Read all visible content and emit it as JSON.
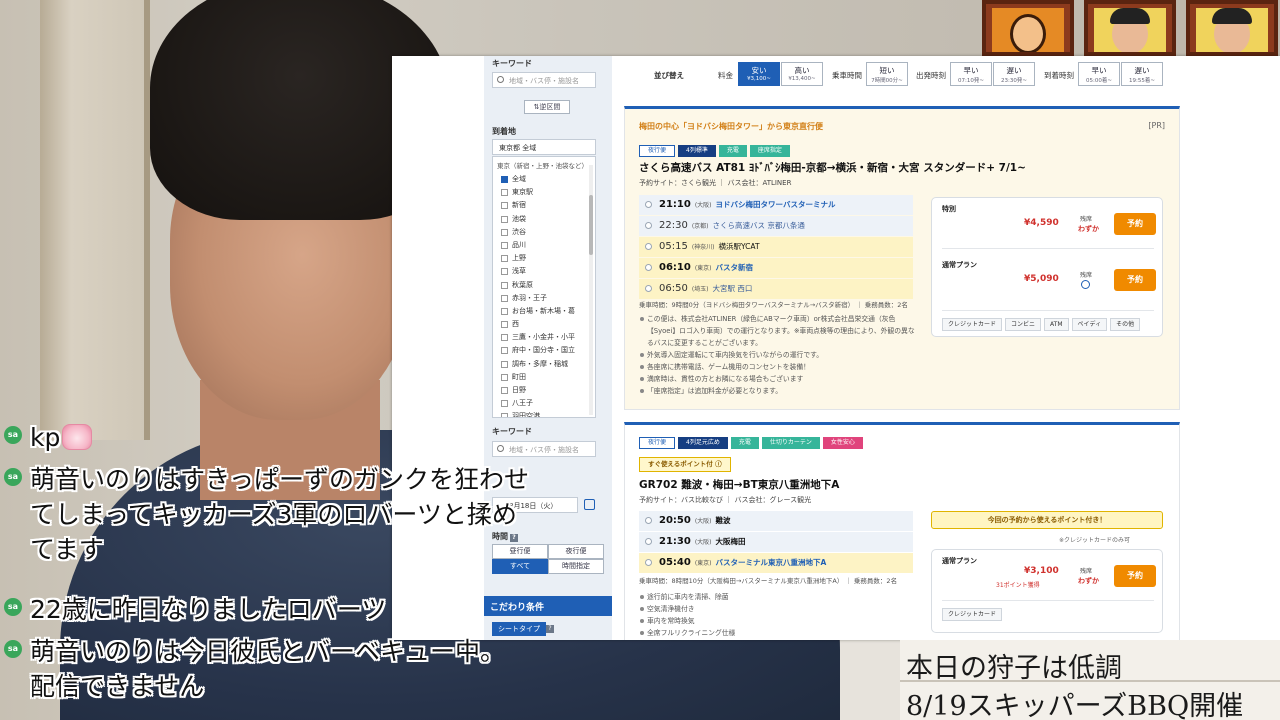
{
  "sidebar": {
    "keyword_label_top": "キーワード",
    "keyword_placeholder_top": "地域・バス停・施設名",
    "swap_label": "⇅逆区間",
    "destination_label": "到着地",
    "destination_value": "東京都 全域",
    "group_label": "東京（新宿・上野・池袋など）",
    "items": [
      {
        "label": "全域",
        "checked": true
      },
      {
        "label": "東京駅",
        "checked": false
      },
      {
        "label": "新宿",
        "checked": false
      },
      {
        "label": "池袋",
        "checked": false
      },
      {
        "label": "渋谷",
        "checked": false
      },
      {
        "label": "品川",
        "checked": false
      },
      {
        "label": "上野",
        "checked": false
      },
      {
        "label": "浅草",
        "checked": false
      },
      {
        "label": "秋葉原",
        "checked": false
      },
      {
        "label": "赤羽・王子",
        "checked": false
      },
      {
        "label": "お台場・新木場・葛",
        "checked": false
      },
      {
        "label": "西",
        "checked": false
      },
      {
        "label": "三鷹・小金井・小平",
        "checked": false
      },
      {
        "label": "府中・国分寺・国立",
        "checked": false
      },
      {
        "label": "調布・多摩・稲城",
        "checked": false
      },
      {
        "label": "町田",
        "checked": false
      },
      {
        "label": "日野",
        "checked": false
      },
      {
        "label": "八王子",
        "checked": false
      },
      {
        "label": "羽田空港",
        "checked": false
      }
    ],
    "keyword_label_bottom": "キーワード",
    "keyword_placeholder_bottom": "地域・バス停・施設名",
    "date_value": "8月18日（火）",
    "time_label": "時間",
    "time_buttons": [
      "昼行便",
      "夜行便",
      "すべて",
      "時間指定"
    ],
    "conditions_label": "こだわり条件",
    "seat_type_label": "シートタイプ"
  },
  "sortbar": {
    "label": "並び替え",
    "groups": [
      {
        "label": "料金",
        "buttons": [
          {
            "top": "安い",
            "sub": "¥3,100~",
            "active": true
          },
          {
            "top": "高い",
            "sub": "¥13,400~",
            "active": false
          }
        ]
      },
      {
        "label": "乗車時間",
        "buttons": [
          {
            "top": "短い",
            "sub": "7時間00分~",
            "active": false
          }
        ]
      },
      {
        "label": "出発時刻",
        "buttons": [
          {
            "top": "早い",
            "sub": "07:10発~",
            "active": false
          },
          {
            "top": "遅い",
            "sub": "23:30発~",
            "active": false
          }
        ]
      },
      {
        "label": "到着時刻",
        "buttons": [
          {
            "top": "早い",
            "sub": "05:00着~",
            "active": false
          },
          {
            "top": "遅い",
            "sub": "19:55着~",
            "active": false
          }
        ]
      }
    ]
  },
  "card1": {
    "headline": "梅田の中心「ヨドバシ梅田タワー」から東京直行便",
    "pr": "[PR]",
    "badges": [
      "夜行便",
      "4列標準",
      "充電",
      "座席指定"
    ],
    "title": "さくら高速バス AT81 ﾖﾄﾞﾊﾞｼ梅田-京都→横浜・新宿・大宮 スタンダード+ 7/1~",
    "meta": "予約サイト：さくら観光 ｜ バス会社：ATLINER",
    "stops": [
      {
        "time": "21:10",
        "pref": "(大阪)",
        "name": "ヨドバシ梅田タワーバスターミナル"
      },
      {
        "time": "22:30",
        "pref": "(京都)",
        "name": "さくら高速バス 京都八条通"
      },
      {
        "time": "05:15",
        "pref": "(神奈川)",
        "name": "横浜駅YCAT"
      },
      {
        "time": "06:10",
        "pref": "(東京)",
        "name": "バスタ新宿"
      },
      {
        "time": "06:50",
        "pref": "(埼玉)",
        "name": "大宮駅 西口"
      }
    ],
    "duration": "乗車時間：9時間0分（ヨドバシ梅田タワーバスターミナル→バスタ新宿） ｜ 乗務員数：2名",
    "notes": [
      "この便は、株式会社ATLINER（緑色にABマーク車両）or株式会社昌栄交通（灰色【Syoei】ロゴ入り車両）での運行となります。※車両点検等の理由により、外観の異なるバスに変更することがございます。",
      "外気導入固定運転にて車内換気を行いながらの運行です。",
      "各座席に携帯電話、ゲーム機用のコンセントを装備！",
      "満席時は、貫性の方とお隣になる場合もございます",
      "「座席指定」は追加料金が必要となります。"
    ],
    "fares": [
      {
        "name": "特別",
        "price": "¥4,590",
        "seat_label": "残席",
        "seat_value": "わずか",
        "button": "予約"
      },
      {
        "name": "通常プラン",
        "price": "¥5,090",
        "seat_label": "残席",
        "seat_value": "",
        "button": "予約"
      }
    ],
    "payments": [
      "クレジットカード",
      "コンビニ",
      "ATM",
      "ペイディ",
      "その他"
    ]
  },
  "card2": {
    "badges": [
      "夜行便",
      "4列足元広め",
      "充電",
      "仕切りカーテン",
      "女性安心"
    ],
    "point_badge": "すぐ使えるポイント付",
    "title": "GR702 難波・梅田→BT東京八重洲地下A",
    "meta": "予約サイト：バス比較なび ｜ バス会社：グレース観光",
    "stops": [
      {
        "time": "20:50",
        "pref": "(大阪)",
        "name": "難波"
      },
      {
        "time": "21:30",
        "pref": "(大阪)",
        "name": "大阪梅田"
      },
      {
        "time": "05:40",
        "pref": "(東京)",
        "name": "バスターミナル東京八重洲地下A"
      }
    ],
    "duration": "乗車時間：8時間10分（大阪梅田→バスターミナル東京八重洲地下A） ｜ 乗務員数：2名",
    "notes": [
      "途行前に車内を清掃、除菌",
      "空気清浄機付き",
      "車内を常時換気",
      "全席フルリクライニング仕様"
    ],
    "point_banner": "今回の予約から使えるポイント付き！",
    "card_note": "※クレジットカードのみ可",
    "fare": {
      "name": "通常プラン",
      "price": "¥3,100",
      "points": "31ポイント獲得",
      "seat_label": "残席",
      "seat_value": "わずか",
      "button": "予約"
    },
    "payments": [
      "クレジットカード"
    ]
  },
  "chat": [
    {
      "icon": "sa",
      "text": "kp"
    },
    {
      "icon": "sa",
      "text": "萌音いのりはすきっぱーずのガンクを狂わせてしまってキッカーズ3軍のロバーツと揉めてます"
    },
    {
      "icon": "sa",
      "text": "22歳に昨日なりましたロバーツ"
    },
    {
      "icon": "sa",
      "text": "萌音いのりは今日彼氏とバーベキュー中。配信できません"
    }
  ],
  "ticker": {
    "line1": "本日の狩子は低調",
    "line2": "8/19スキッパーズBBQ開催"
  },
  "colors": {
    "brand": "#1f5fb5",
    "accent": "#f08a00",
    "price": "#d0312d",
    "pr_headline": "#d27f16",
    "chat_icon": "#3aa65b"
  }
}
